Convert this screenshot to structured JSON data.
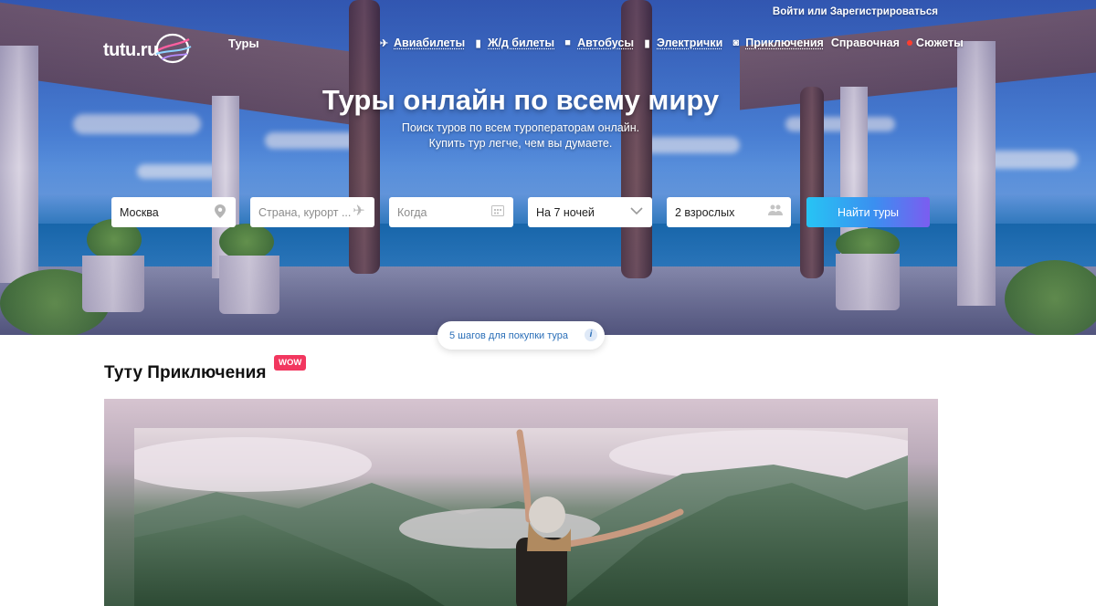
{
  "header": {
    "login_link": "Войти или Зарегистрироваться",
    "logo_text": "tutu.ru",
    "section_label": "Туры",
    "nav": [
      {
        "icon": "plane-icon",
        "label": "Авиабилеты"
      },
      {
        "icon": "train-icon",
        "label": "Ж/д билеты"
      },
      {
        "icon": "bus-icon",
        "label": "Автобусы"
      },
      {
        "icon": "suburban-train-icon",
        "label": "Электрички"
      },
      {
        "icon": "camera-icon",
        "label": "Приключения"
      },
      {
        "icon": "",
        "label": "Справочная"
      },
      {
        "icon": "red-dot-icon",
        "label": "Сюжеты"
      }
    ]
  },
  "hero": {
    "title": "Туры онлайн по всему миру",
    "subtitle_line1": "Поиск туров по всем туроператорам онлайн.",
    "subtitle_line2": "Купить тур легче, чем вы думаете."
  },
  "search": {
    "from_value": "Москва",
    "destination_placeholder": "Страна, курорт ...",
    "date_placeholder": "Когда",
    "nights_value": "На 7 ночей",
    "guests_value": "2 взрослых",
    "submit_label": "Найти туры"
  },
  "steps_button": {
    "label": "5 шагов для покупки тура"
  },
  "adventures": {
    "title": "Туту Приключения",
    "badge": "WOW"
  },
  "colors": {
    "accent_gradient_start": "#27c4f4",
    "accent_gradient_end": "#7b5df0",
    "badge_red": "#f2375f",
    "link_blue": "#2b6fb8"
  }
}
